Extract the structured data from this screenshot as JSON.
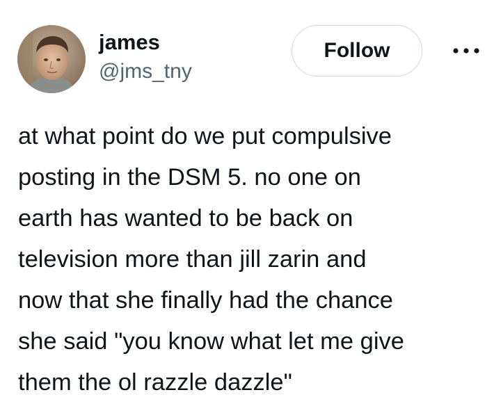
{
  "author": {
    "display_name": "james",
    "handle": "@jms_tny"
  },
  "actions": {
    "follow_label": "Follow",
    "more_icon": "more-horizontal-icon"
  },
  "tweet": {
    "lines": [
      "at what point do we put compulsive",
      "posting in the DSM 5. no one on",
      "earth has wanted to be back on",
      "television more than jill zarin and",
      "now that she finally had the chance",
      "she said \"you know what let me give",
      "them the ol razzle dazzle\""
    ]
  },
  "colors": {
    "text_primary": "#0f1419",
    "text_secondary": "#536471",
    "button_border": "#cfd9de",
    "background": "#ffffff"
  }
}
